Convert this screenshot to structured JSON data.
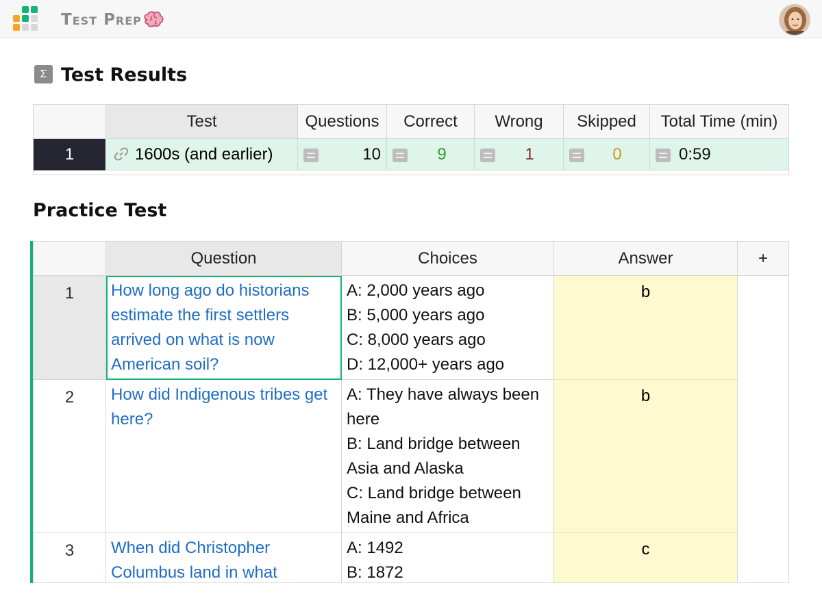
{
  "app": {
    "title": "Test Prep"
  },
  "results_section": {
    "icon_glyph": "Σ",
    "title": "Test Results",
    "columns": [
      "Test",
      "Questions",
      "Correct",
      "Wrong",
      "Skipped",
      "Total Time (min)"
    ],
    "rows": [
      {
        "row_num": "1",
        "test": "1600s (and earlier)",
        "questions": "10",
        "correct": "9",
        "wrong": "1",
        "skipped": "0",
        "total_time": "0:59"
      }
    ]
  },
  "practice_section": {
    "title": "Practice Test",
    "columns": [
      "Question",
      "Choices",
      "Answer",
      "+"
    ],
    "rows": [
      {
        "row_num": "1",
        "question": "How long ago do historians estimate the first settlers arrived on what is now American soil?",
        "choices": [
          "A: 2,000 years ago",
          "B: 5,000 years ago",
          "C: 8,000 years ago",
          "D: 12,000+ years ago"
        ],
        "answer": "b"
      },
      {
        "row_num": "2",
        "question": "How did Indigenous tribes get here?",
        "choices": [
          "A: They have always been here",
          "B: Land bridge between Asia and Alaska",
          "C: Land bridge between Maine and Africa"
        ],
        "answer": "b"
      },
      {
        "row_num": "3",
        "question": "When did Christopher Columbus land in what",
        "choices": [
          "A: 1492",
          "B: 1872"
        ],
        "answer": "c"
      }
    ]
  },
  "colors": {
    "correct": "#2aa02a",
    "wrong": "#8b2a2a",
    "skipped": "#c99a14",
    "link": "#1f6dc5",
    "accent_green": "#16b378",
    "answer_bg": "#fff9cf"
  },
  "icons": {
    "logo": "grist-logo-icon",
    "title_emoji": "brain-icon",
    "link": "link-icon",
    "formula": "equals-icon",
    "avatar": "user-avatar"
  }
}
